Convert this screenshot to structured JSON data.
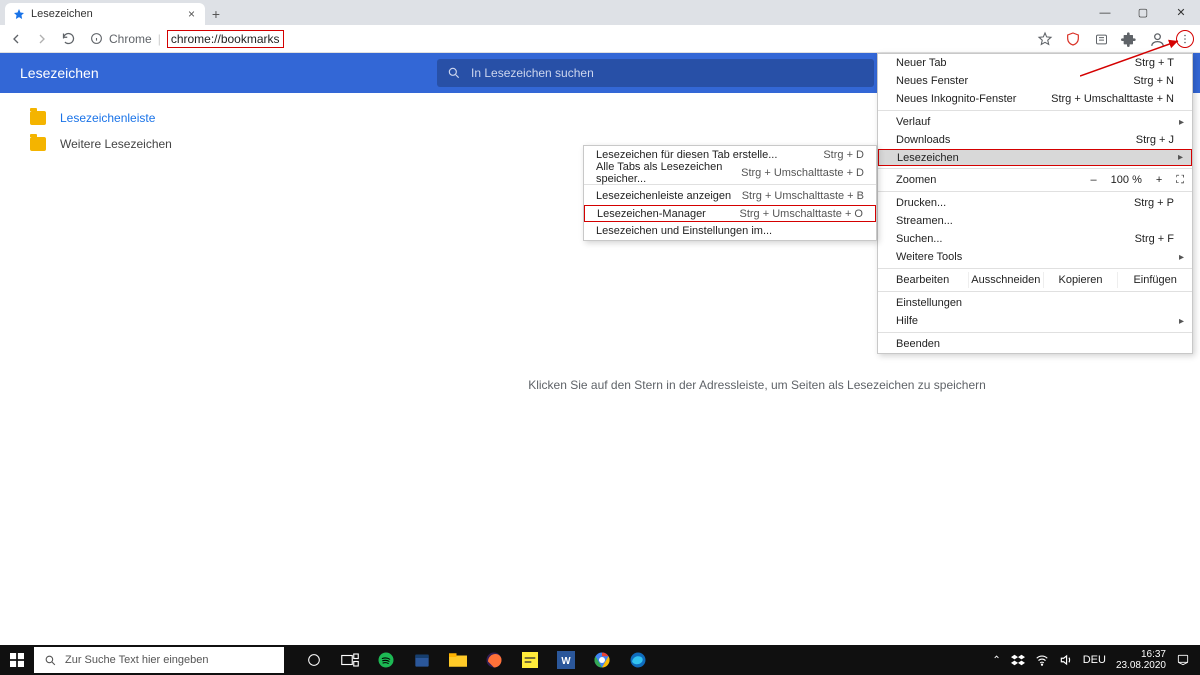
{
  "window": {
    "tab_title": "Lesezeichen",
    "min": "—",
    "max": "▢",
    "close": "✕"
  },
  "toolbar": {
    "chip": "Chrome",
    "url": "chrome://bookmarks"
  },
  "bookmarks": {
    "header": "Lesezeichen",
    "search_placeholder": "In Lesezeichen suchen",
    "sidebar": [
      {
        "label": "Lesezeichenleiste"
      },
      {
        "label": "Weitere Lesezeichen"
      }
    ],
    "hint": "Klicken Sie auf den Stern in der Adressleiste, um Seiten als Lesezeichen zu speichern"
  },
  "submenu": {
    "items": [
      {
        "label": "Lesezeichen für diesen Tab erstelle...",
        "shortcut": "Strg + D"
      },
      {
        "label": "Alle Tabs als Lesezeichen speicher...",
        "shortcut": "Strg + Umschalttaste + D"
      }
    ],
    "items2": [
      {
        "label": "Lesezeichenleiste anzeigen",
        "shortcut": "Strg + Umschalttaste + B"
      },
      {
        "label": "Lesezeichen-Manager",
        "shortcut": "Strg + Umschalttaste + O",
        "highlight": true
      },
      {
        "label": "Lesezeichen und Einstellungen im...",
        "shortcut": ""
      }
    ]
  },
  "mainmenu": {
    "group1": [
      {
        "label": "Neuer Tab",
        "shortcut": "Strg + T"
      },
      {
        "label": "Neues Fenster",
        "shortcut": "Strg + N"
      },
      {
        "label": "Neues Inkognito-Fenster",
        "shortcut": "Strg + Umschalttaste + N"
      }
    ],
    "group2": [
      {
        "label": "Verlauf",
        "shortcut": "",
        "sub": true
      },
      {
        "label": "Downloads",
        "shortcut": "Strg + J"
      },
      {
        "label": "Lesezeichen",
        "shortcut": "",
        "sub": true,
        "selected": true
      }
    ],
    "zoom": {
      "label": "Zoomen",
      "minus": "–",
      "value": "100 %",
      "plus": "+",
      "full": "⛶"
    },
    "group3": [
      {
        "label": "Drucken...",
        "shortcut": "Strg + P"
      },
      {
        "label": "Streamen...",
        "shortcut": ""
      },
      {
        "label": "Suchen...",
        "shortcut": "Strg + F"
      },
      {
        "label": "Weitere Tools",
        "shortcut": "",
        "sub": true
      }
    ],
    "edit": {
      "label": "Bearbeiten",
      "cut": "Ausschneiden",
      "copy": "Kopieren",
      "paste": "Einfügen"
    },
    "group4": [
      {
        "label": "Einstellungen",
        "shortcut": ""
      },
      {
        "label": "Hilfe",
        "shortcut": "",
        "sub": true
      }
    ],
    "group5": [
      {
        "label": "Beenden",
        "shortcut": ""
      }
    ]
  },
  "taskbar": {
    "search_placeholder": "Zur Suche Text hier eingeben",
    "lang": "DEU",
    "time": "16:37",
    "date": "23.08.2020"
  }
}
